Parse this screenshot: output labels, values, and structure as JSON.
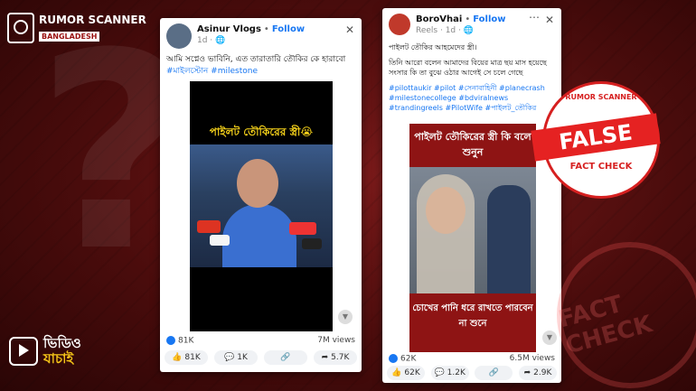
{
  "brand": {
    "name": "RUMOR SCANNER",
    "country": "BANGLADESH",
    "video_logo_line1": "ভিডিও",
    "video_logo_line2": "যাচাই"
  },
  "post1": {
    "author": "Asinur Vlogs",
    "follow": "Follow",
    "meta": "1d · 🌐",
    "caption": "আমি সপ্নেও ভাবিনি, এত তারাতারি তৌকির কে হারাবো",
    "tags": "#মাইলস্টোন #milestone",
    "media_title": "পাইলট তৌকিরের স্ত্রী😭",
    "reactions": "81K",
    "views": "7M views",
    "actions": {
      "like": "81K",
      "comment": "1K",
      "share": "5.7K"
    }
  },
  "post2": {
    "author": "BoroVhai",
    "follow": "Follow",
    "meta": "Reels · 1d · 🌐",
    "caption_line1": "পাইলট তৌকির আহমেদের স্ত্রী।",
    "caption_line2": "তিনি আরো বলেন আমাদের বিয়ের মাত্র ছয় মাস হয়েছে সংসার কি তা বুঝে ওঠার আগেই সে চলে গেছে",
    "tags": "#pilottaukir #pilot #সেনাবাহিনী #planecrash #milestonecollege #bdviralnews #trandingreels #PilotWife #পাইলট_তৌকির",
    "media_title": "পাইলট তৌকিরের স্ত্রী কি বলে শুনুন",
    "media_sub": "চোখের পানি ধরে রাখতে পারবেন না শুনে",
    "reactions": "62K",
    "views": "6.5M views",
    "actions": {
      "like": "62K",
      "comment": "1.2K",
      "share": "2.9K"
    }
  },
  "stamp": {
    "top": "RUMOR SCANNER",
    "verdict": "FALSE",
    "bottom": "FACT CHECK"
  },
  "watermark": "FACT CHECK",
  "colors": {
    "accent": "#1877f2",
    "false_red": "#e52222",
    "background": "#5a0f0f"
  }
}
